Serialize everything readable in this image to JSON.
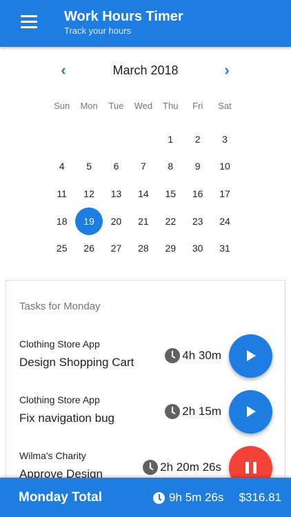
{
  "app": {
    "title": "Work Hours Timer",
    "subtitle": "Track your hours"
  },
  "calendar": {
    "month_label": "March 2018",
    "weekdays": [
      "Sun",
      "Mon",
      "Tue",
      "Wed",
      "Thu",
      "Fri",
      "Sat"
    ],
    "leading_blanks": 4,
    "days": [
      1,
      2,
      3,
      4,
      5,
      6,
      7,
      8,
      9,
      10,
      11,
      12,
      13,
      14,
      15,
      16,
      17,
      18,
      19,
      20,
      21,
      22,
      23,
      24,
      25,
      26,
      27,
      28,
      29,
      30,
      31
    ],
    "selected_day": 19
  },
  "tasks": {
    "heading": "Tasks for Monday",
    "items": [
      {
        "project": "Clothing Store App",
        "name": "Design Shopping Cart",
        "duration": "4h 30m",
        "state": "stopped",
        "action_icon": "play-icon"
      },
      {
        "project": "Clothing Store App",
        "name": "Fix navigation bug",
        "duration": "2h 15m",
        "state": "stopped",
        "action_icon": "play-icon"
      },
      {
        "project": "Wilma's Charity",
        "name": "Approve Design",
        "duration": "2h 20m 26s",
        "state": "running",
        "action_icon": "pause-icon"
      }
    ]
  },
  "total": {
    "label": "Monday Total",
    "time": "9h 5m 26s",
    "amount": "$316.81"
  },
  "colors": {
    "primary": "#1e7de1",
    "running": "#f44336",
    "clock": "#616161"
  }
}
